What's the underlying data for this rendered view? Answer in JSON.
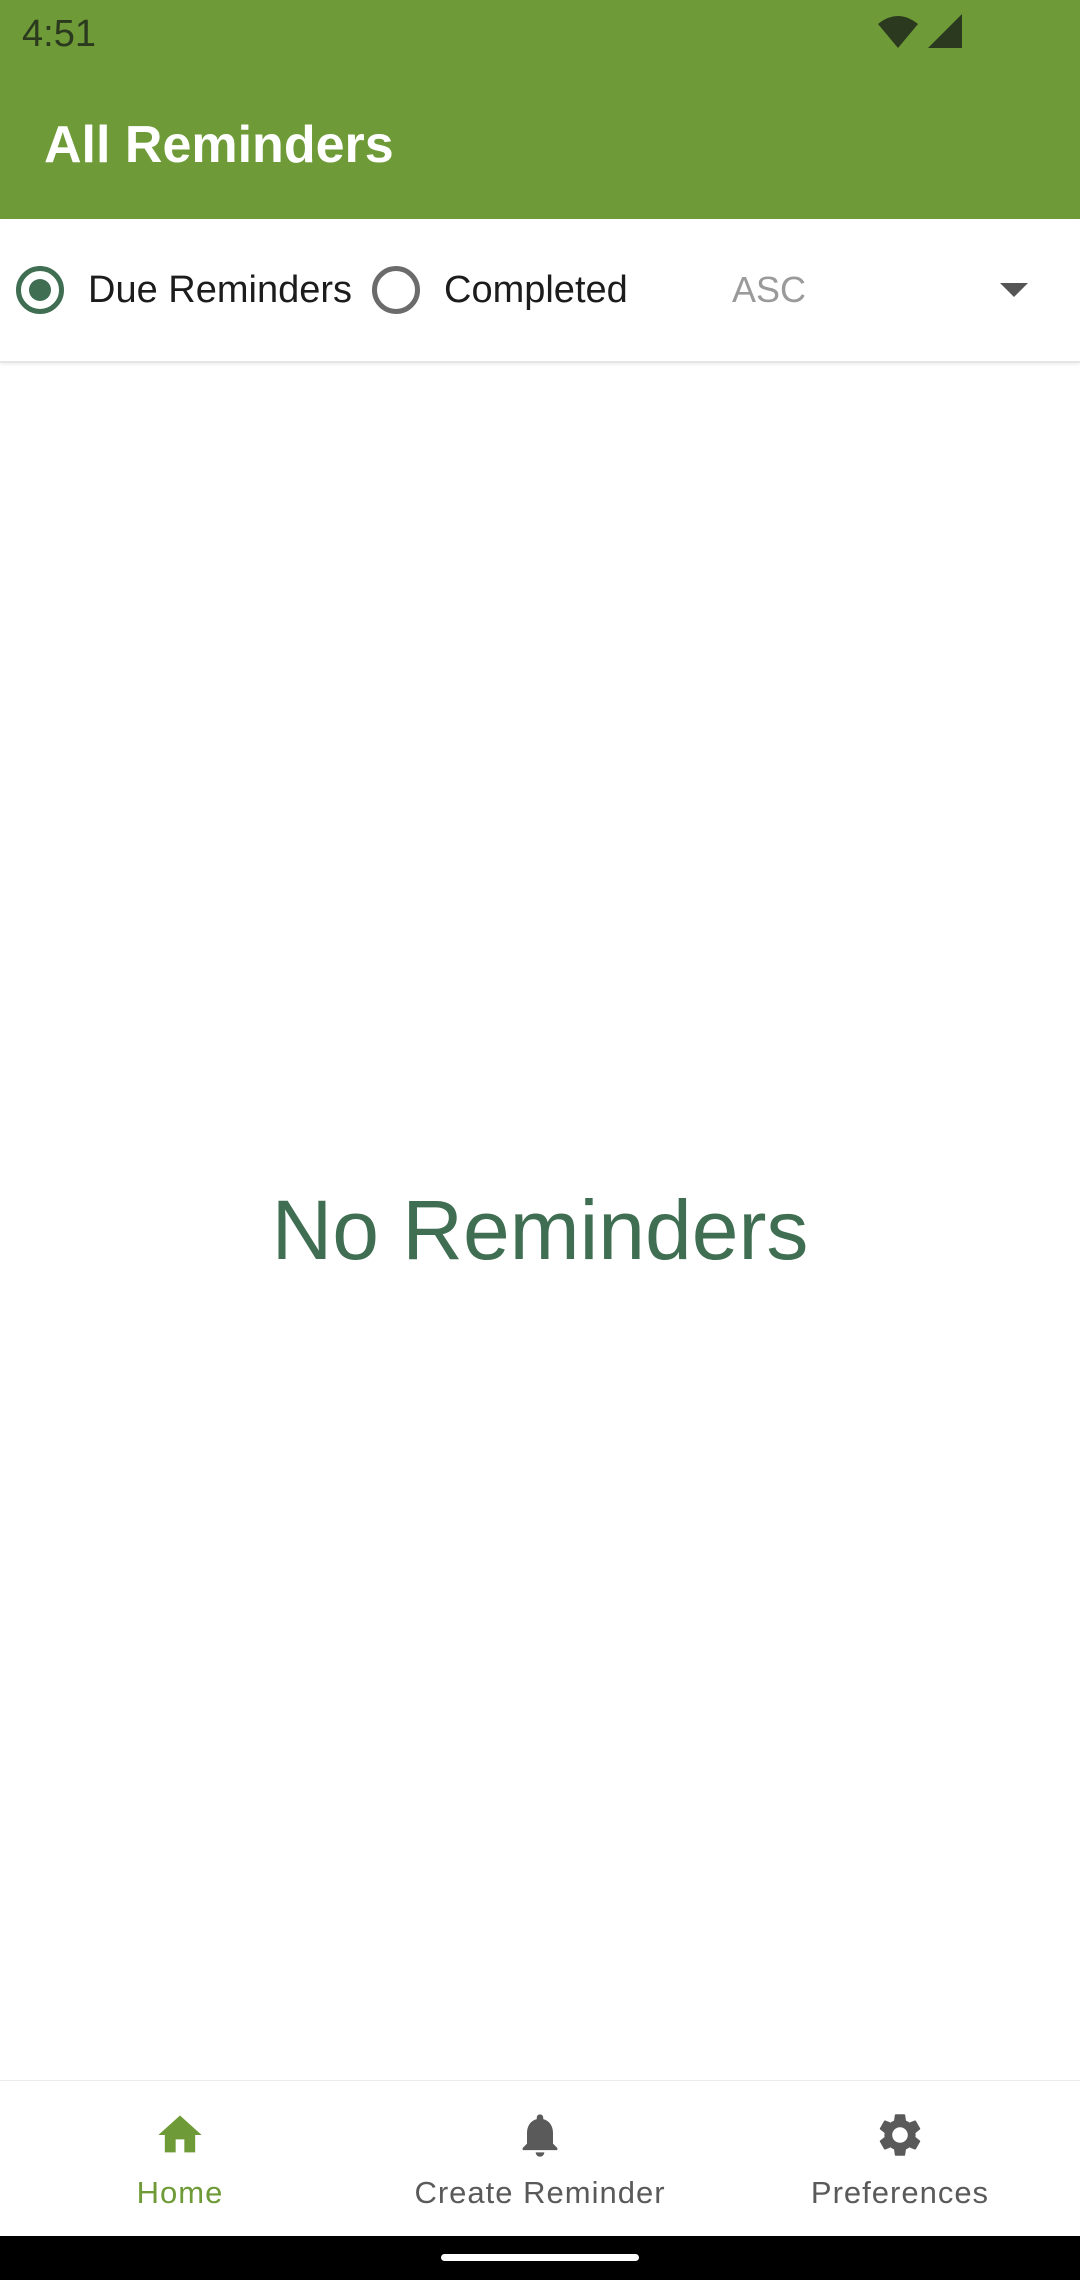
{
  "status_bar": {
    "time": "4:51",
    "icons": [
      "wifi-icon",
      "cell-signal-icon"
    ]
  },
  "app_bar": {
    "title": "All Reminders",
    "color": "#6e9a37"
  },
  "filters": {
    "options": [
      {
        "label": "Due Reminders",
        "selected": true
      },
      {
        "label": "Completed",
        "selected": false
      }
    ],
    "sort": {
      "value": "ASC",
      "icon": "dropdown-arrow-icon"
    }
  },
  "empty_state": {
    "message": "No Reminders",
    "color": "#3f6e52"
  },
  "bottom_nav": {
    "items": [
      {
        "label": "Home",
        "icon": "home-icon",
        "active": true
      },
      {
        "label": "Create Reminder",
        "icon": "bell-icon",
        "active": false
      },
      {
        "label": "Preferences",
        "icon": "gear-icon",
        "active": false
      }
    ],
    "active_color": "#6e9a37"
  }
}
